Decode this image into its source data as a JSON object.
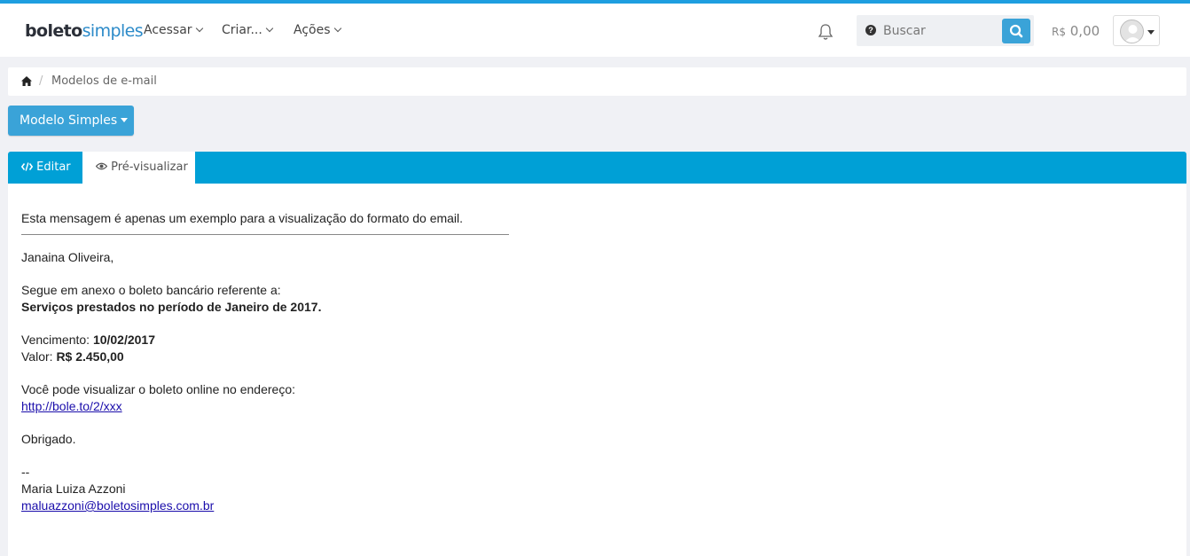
{
  "app": {
    "logo_part1": "boleto",
    "logo_part2": "simples"
  },
  "nav": {
    "items": [
      {
        "label": "Acessar"
      },
      {
        "label": "Criar..."
      },
      {
        "label": "Ações"
      }
    ]
  },
  "search": {
    "placeholder": "Buscar"
  },
  "balance": {
    "currency": "R$",
    "amount": "0,00"
  },
  "breadcrumb": {
    "current": "Modelos de e-mail"
  },
  "model_selector": {
    "label": "Modelo Simples"
  },
  "tabs": [
    {
      "label": "Editar",
      "icon": "code-icon",
      "active": false
    },
    {
      "label": "Pré-visualizar",
      "icon": "eye-icon",
      "active": true
    }
  ],
  "email": {
    "intro": "Esta mensagem é apenas um exemplo para a visualização do formato do email.",
    "greeting": "Janaina Oliveira,",
    "attachment_text": "Segue em anexo o boleto bancário referente a:",
    "description": "Serviços prestados no período de Janeiro de 2017.",
    "due_label": "Vencimento: ",
    "due_date": "10/02/2017",
    "value_label": "Valor: ",
    "value": "R$ 2.450,00",
    "online_text": "Você pode visualizar o boleto online no endereço:",
    "link": "http://bole.to/2/xxx",
    "thanks": "Obrigado.",
    "signature_sep": "--",
    "signature_name": "Maria Luiza Azzoni",
    "signature_email": "maluazzoni@boletosimples.com.br"
  },
  "colors": {
    "accent": "#1e9ee0",
    "tab_bar": "#00a0d6",
    "button": "#3aa3d8",
    "link": "#1a0dab"
  }
}
